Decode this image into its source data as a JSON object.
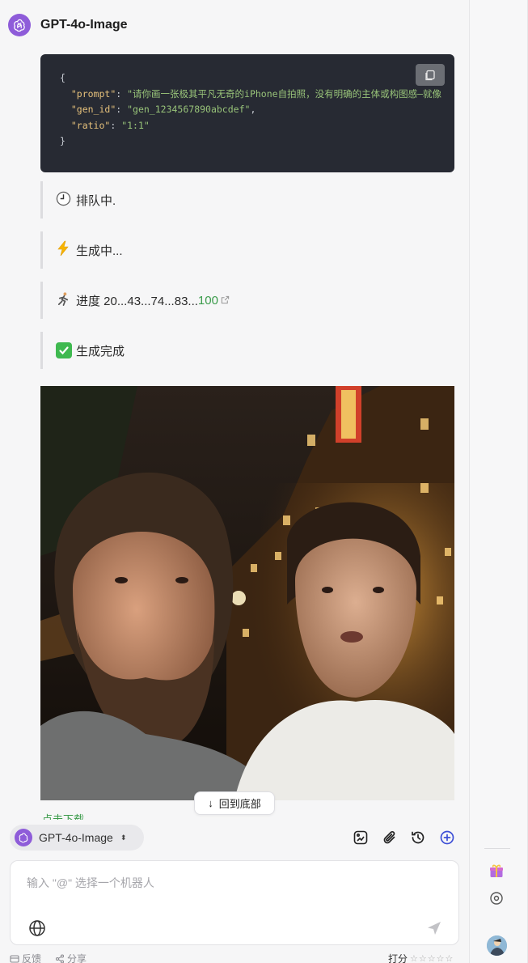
{
  "header": {
    "title": "GPT-4o-Image",
    "avatar_icon": "openai-logo-icon"
  },
  "code": {
    "line1": "{",
    "prompt_key": "\"prompt\"",
    "prompt_val": "\"请你画一张极其平凡无奇的iPhone自拍照，没有明确的主体或构图感—就像",
    "gen_id_key": "\"gen_id\"",
    "gen_id_val": "\"gen_1234567890abcdef\"",
    "ratio_key": "\"ratio\"",
    "ratio_val": "\"1:1\"",
    "line_end": "}"
  },
  "statuses": {
    "queue": "排队中.",
    "generating": "生成中...",
    "progress_prefix": "进度 20...43...74...83...",
    "progress_final": "100",
    "done": "生成完成"
  },
  "download_label": "点击下载",
  "back_to_bottom": "回到底部",
  "bot_selector": {
    "label": "GPT-4o-Image",
    "updown": "⬍"
  },
  "input": {
    "placeholder": "输入 \"@\" 选择一个机器人"
  },
  "footer": {
    "feedback": "反馈",
    "share": "分享",
    "rate": "打分",
    "stars": "☆☆☆☆☆"
  },
  "colors": {
    "accent_green": "#3a9b4a",
    "bot_purple": "#8e5cd9",
    "code_bg": "#272a33"
  }
}
